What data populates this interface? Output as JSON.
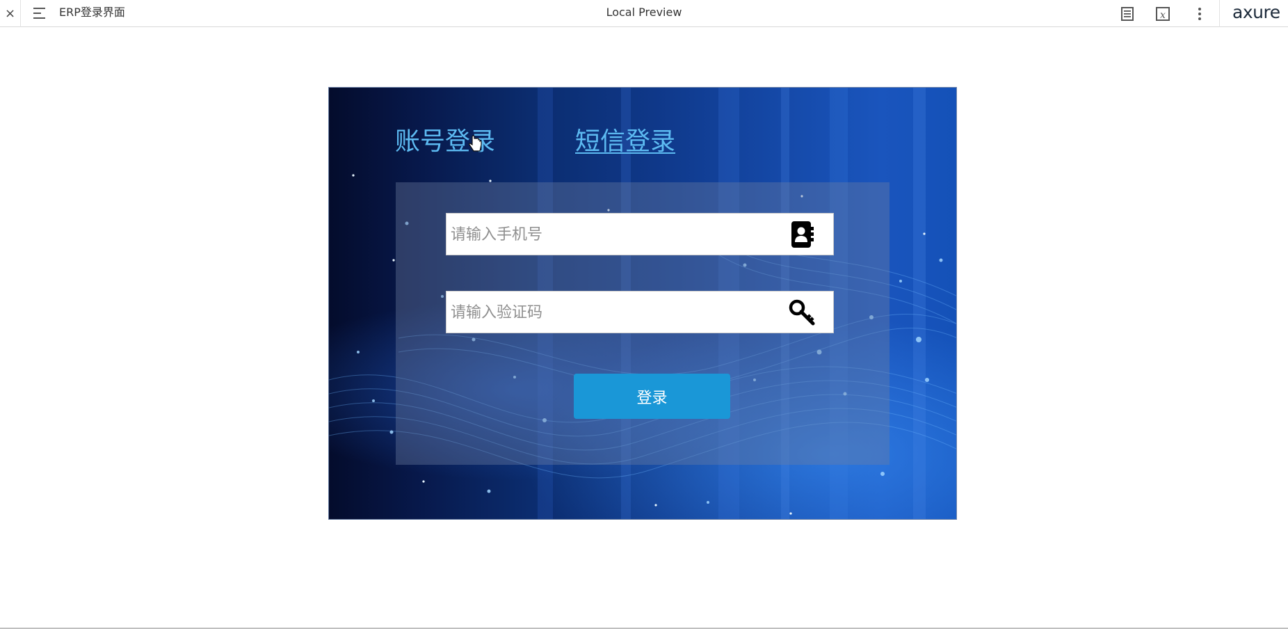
{
  "toolbar": {
    "close_glyph": "×",
    "title": "ERP登录界面",
    "center_label": "Local Preview",
    "brand": "axure",
    "icons": [
      "menu-icon",
      "page-notes-icon",
      "variables-icon",
      "more-icon"
    ]
  },
  "login": {
    "tabs": [
      {
        "label": "账号登录",
        "active": false
      },
      {
        "label": "短信登录",
        "active": true
      }
    ],
    "phone": {
      "placeholder": "请输入手机号",
      "value": "",
      "icon": "contact-book-icon"
    },
    "code": {
      "placeholder": "请输入验证码",
      "value": "",
      "icon": "key-icon"
    },
    "submit_label": "登录"
  },
  "colors": {
    "tab_text": "#5dbbf2",
    "button": "#1a97d7",
    "panel_dark": "#040c2c",
    "panel_light": "#1a55bd"
  }
}
